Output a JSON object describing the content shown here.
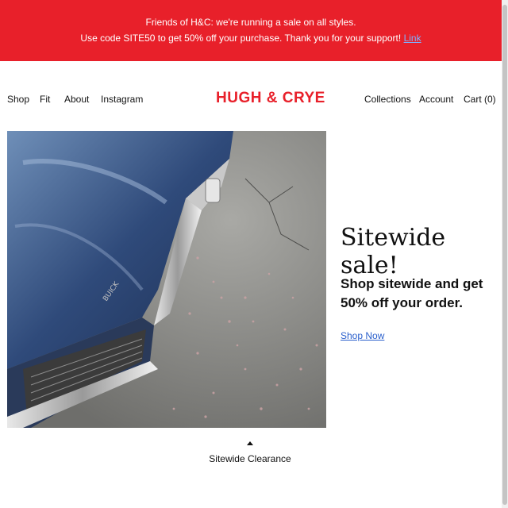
{
  "announcement": {
    "line1": "Friends of H&C: we're running a sale on all styles.",
    "line2_prefix": "Use code SITE50 to get 50% off your purchase.",
    "line2_suffix": "Thank you for your support!",
    "link_label": "Link"
  },
  "nav": {
    "left": [
      "Shop",
      "Fit",
      "About",
      "Instagram"
    ],
    "logo": "HUGH & CRYE",
    "right": [
      "Collections",
      "Account",
      "Cart (0)"
    ]
  },
  "hero": {
    "title": "Sitewide sale!",
    "subtitle": "Shop sitewide and get 50% off your order.",
    "cta_label": "Shop Now",
    "image_caption": "Sitewide Clearance"
  },
  "colors": {
    "brand_red": "#e8202a",
    "link_blue": "#2a5fcc"
  },
  "icons": {
    "caption_arrow": "caret-up-icon"
  }
}
